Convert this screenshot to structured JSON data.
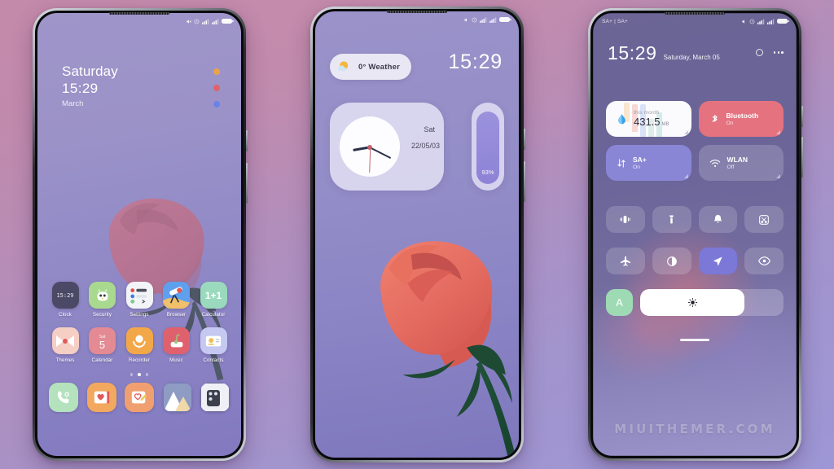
{
  "meta": {
    "watermark": "MIUITHEMER.COM",
    "background_top": "#c489a9",
    "background_bottom": "#9d97d6"
  },
  "phone1": {
    "name": "lockscreen",
    "statusbar": {
      "left": "",
      "icons": [
        "mute-icon",
        "alarm-icon",
        "signal-1-icon",
        "signal-2-icon",
        "battery-icon"
      ]
    },
    "lockscreen": {
      "day": "Saturday",
      "time": "15:29",
      "month": "March",
      "dots": [
        {
          "name": "shortcut-dot-orange",
          "color": "#e8a34a"
        },
        {
          "name": "shortcut-dot-red",
          "color": "#e0636b"
        },
        {
          "name": "shortcut-dot-blue",
          "color": "#6a83e8"
        }
      ]
    },
    "apps_row1": [
      {
        "label": "Clock",
        "icon": "clock-app-icon",
        "bg": "#4a4a66"
      },
      {
        "label": "Security",
        "icon": "security-app-icon",
        "bg": "#a8d98f"
      },
      {
        "label": "Settings",
        "icon": "settings-app-icon",
        "bg": "#f2f4f7"
      },
      {
        "label": "Browser",
        "icon": "browser-app-icon",
        "bg": "#5fa0ee"
      },
      {
        "label": "Calculator",
        "icon": "calculator-app-icon",
        "bg": "#9ad9bd"
      }
    ],
    "apps_row2": [
      {
        "label": "Themes",
        "icon": "themes-app-icon",
        "bg": "#f5cec4"
      },
      {
        "label": "Calendar",
        "icon": "calendar-app-icon",
        "bg": "#e38a93"
      },
      {
        "label": "Recorder",
        "icon": "recorder-app-icon",
        "bg": "#f2a849"
      },
      {
        "label": "Music",
        "icon": "music-app-icon",
        "bg": "#e0616e"
      },
      {
        "label": "Contacts",
        "icon": "contacts-app-icon",
        "bg": "#c5c8f0"
      }
    ],
    "clock_icon_time": "15:29",
    "calendar_icon_day": "Sat",
    "calendar_icon_date": "5",
    "calculator_icon_text": "1+1",
    "page_dots": {
      "count": 3,
      "active_index": 1
    },
    "dock": [
      {
        "label": "Phone",
        "icon": "phone-app-icon",
        "bg": "#b3e2bd"
      },
      {
        "label": "Messages",
        "icon": "messages-app-icon",
        "bg": "#f2a85f"
      },
      {
        "label": "Notes",
        "icon": "notes-app-icon",
        "bg": "#f0a070"
      },
      {
        "label": "Gallery",
        "icon": "gallery-app-icon",
        "bg": "#6e7fb0"
      },
      {
        "label": "Camera",
        "icon": "camera-app-icon",
        "bg": "#6d7295"
      }
    ]
  },
  "phone2": {
    "name": "home-widgets",
    "weather": {
      "temp_label": "0° Weather",
      "icon": "sun-cloud-icon"
    },
    "time": "15:29",
    "clock_widget": {
      "day": "Sat",
      "date": "22/05/03"
    },
    "battery_widget": {
      "percent_label": "93%",
      "percent_value": 93
    }
  },
  "phone3": {
    "name": "control-center",
    "statusbar": {
      "left": "SA+ | SA+",
      "icons": [
        "mute-icon",
        "alarm-icon",
        "signal-1-icon",
        "signal-2-icon",
        "battery-icon"
      ]
    },
    "time": "15:29",
    "date": "Saturday, March 05",
    "big_tiles": [
      {
        "name": "data-usage-tile",
        "icon": "water-drop-icon",
        "sub": "this month",
        "value": "431.5",
        "unit": "MB",
        "bg": "#fbfbfd",
        "fg": "#2f2d3d"
      },
      {
        "name": "bluetooth-tile",
        "icon": "bluetooth-icon",
        "label": "Bluetooth",
        "sub": "On",
        "bg": "#e4737f",
        "fg": "#ffffff"
      }
    ],
    "toggle_tiles": [
      {
        "name": "mobile-data-tile",
        "icon": "data-arrows-icon",
        "label": "SA+",
        "sub": "On",
        "bg": "#8a86d6",
        "fg": "#ffffff"
      },
      {
        "name": "wlan-tile",
        "icon": "wifi-icon",
        "label": "WLAN",
        "sub": "Off",
        "bg": "rgba(255,255,255,0.18)",
        "fg": "#ffffff"
      }
    ],
    "toggles_row1": [
      {
        "name": "vibrate-toggle",
        "icon": "vibrate-icon",
        "active": false
      },
      {
        "name": "flashlight-toggle",
        "icon": "flashlight-icon",
        "active": false
      },
      {
        "name": "ringer-toggle",
        "icon": "bell-icon",
        "active": false
      },
      {
        "name": "screenshot-toggle",
        "icon": "scissors-icon",
        "active": false
      }
    ],
    "toggles_row2": [
      {
        "name": "airplane-toggle",
        "icon": "airplane-icon",
        "active": false
      },
      {
        "name": "dark-mode-toggle",
        "icon": "contrast-icon",
        "active": false
      },
      {
        "name": "location-toggle",
        "icon": "navigation-icon",
        "active": true
      },
      {
        "name": "reading-toggle",
        "icon": "eye-icon",
        "active": false
      }
    ],
    "brightness": {
      "auto_label": "A",
      "icon": "sun-icon",
      "value": 73
    }
  }
}
